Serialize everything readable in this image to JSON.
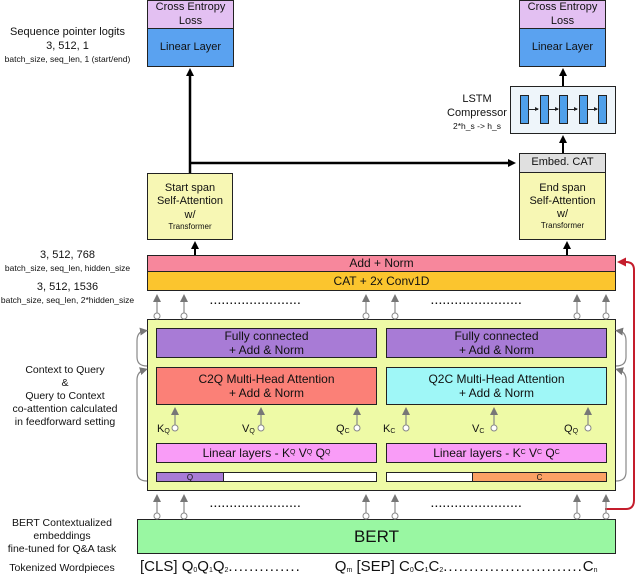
{
  "colors": {
    "loss": "#e3c0f2",
    "linear_output": "#5aa2f0",
    "self_attention": "#f7f7b4",
    "embed_cat": "#e0e0e0",
    "lstm_bg": "#eef5fa",
    "lstm_cell": "#4fa0ea",
    "add_norm": "#f7879c",
    "cat_conv": "#fbc52e",
    "coattention_bg": "#eefaa6",
    "fully_connected": "#a87bd6",
    "c2q": "#fb8077",
    "q2c": "#9ff7f7",
    "linear_layers": "#f99cf7",
    "query_seg": "#a87bd6",
    "context_seg": "#fba165",
    "bert": "#99f7a2",
    "residual_arrow": "#c41d2c"
  },
  "left_annotations": {
    "logits": {
      "title": "Sequence pointer logits",
      "shape": "3, 512, 1",
      "dims": "batch_size, seq_len, 1 (start/end)"
    },
    "hidden": {
      "shape": "3, 512, 768",
      "dims": "batch_size, seq_len, hidden_size"
    },
    "concat": {
      "shape": "3, 512, 1536",
      "dims": "batch_size, seq_len, 2*hidden_size"
    },
    "coattention": {
      "line1": "Context to Query",
      "line2": "&",
      "line3": "Query to Context",
      "line4": "co-attention calculated",
      "line5": "in feedforward setting"
    },
    "bert": {
      "line1": "BERT Contextualized",
      "line2": "embeddings",
      "line3": "fine-tuned for Q&A task"
    },
    "tokens": "Tokenized Wordpieces"
  },
  "start_head": {
    "loss": {
      "line1": "Cross Entropy",
      "line2": "Loss"
    },
    "linear": "Linear Layer",
    "attention": {
      "line1": "Start span",
      "line2": "Self-Attention",
      "line3": "w/",
      "line4": "Transformer"
    }
  },
  "end_head": {
    "loss": {
      "line1": "Cross Entropy",
      "line2": "Loss"
    },
    "linear": "Linear Layer",
    "lstm": {
      "line1": "LSTM",
      "line2": "Compressor",
      "line3": "2*h_s -> h_s"
    },
    "embed_cat": "Embed. CAT",
    "attention": {
      "line1": "End span",
      "line2": "Self-Attention",
      "line3": "w/",
      "line4": "Transformer"
    }
  },
  "add_norm": "Add + Norm",
  "cat_conv": "CAT + 2x Conv1D",
  "c2q_block": {
    "fully_connected": {
      "line1": "Fully connected",
      "line2": "+ Add & Norm"
    },
    "attention": {
      "line1": "C2Q Multi-Head Attention",
      "line2": "+ Add & Norm"
    },
    "inputs": [
      {
        "main": "K",
        "sub": "Q"
      },
      {
        "main": "V",
        "sub": "Q"
      },
      {
        "main": "Q",
        "sub": "C"
      }
    ],
    "linear": {
      "prefix": "Linear layers - ",
      "terms": [
        {
          "main": "K",
          "sub": "Q"
        },
        {
          "main": "V",
          "sub": "Q"
        },
        {
          "main": "Q",
          "sub": "Q"
        }
      ]
    },
    "segment_label": "Q"
  },
  "q2c_block": {
    "fully_connected": {
      "line1": "Fully connected",
      "line2": "+ Add & Norm"
    },
    "attention": {
      "line1": "Q2C Multi-Head Attention",
      "line2": "+ Add & Norm"
    },
    "inputs": [
      {
        "main": "K",
        "sub": "C"
      },
      {
        "main": "V",
        "sub": "C"
      },
      {
        "main": "Q",
        "sub": "Q"
      }
    ],
    "linear": {
      "prefix": "Linear layers - ",
      "terms": [
        {
          "main": "K",
          "sub": "C"
        },
        {
          "main": "V",
          "sub": "C"
        },
        {
          "main": "Q",
          "sub": "C"
        }
      ]
    },
    "segment_label": "C"
  },
  "bert": "BERT",
  "tokens": {
    "cls": "[CLS]",
    "q0": "Q",
    "q0s": "0",
    "q1": "Q",
    "q1s": "1",
    "q2": "Q",
    "q2s": "2",
    "dots1": "..............",
    "qm": "Q",
    "qms": "m",
    "sep": "[SEP]",
    "c0": "C",
    "c0s": "0",
    "c1": "C",
    "c1s": "1",
    "c2": "C",
    "c2s": "2",
    "dots2": "...........................",
    "cn": "C",
    "cns": "n"
  },
  "ellipsis": "......................."
}
